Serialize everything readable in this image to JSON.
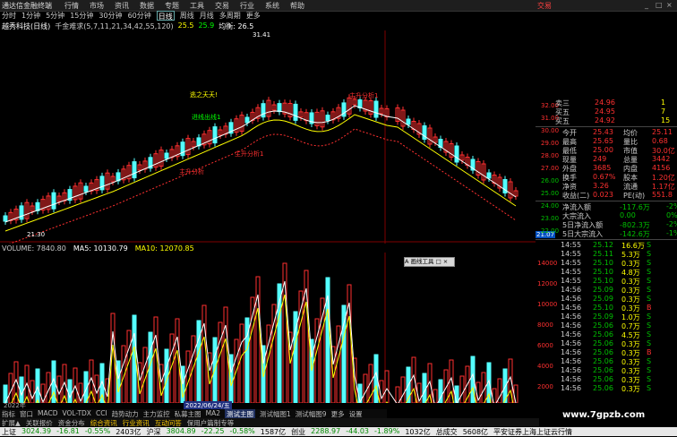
{
  "menubar": {
    "app_title": "通达信金融终端",
    "items": [
      "行情",
      "市场",
      "资讯",
      "数据",
      "专题",
      "工具",
      "交易",
      "行业",
      "系统",
      "帮助"
    ],
    "trade_label": "交易",
    "win_buttons": [
      "_",
      "□",
      "×"
    ]
  },
  "periodbar": {
    "items": [
      "分时",
      "1分钟",
      "5分钟",
      "15分钟",
      "30分钟",
      "60分钟",
      "日线",
      "周线",
      "月线",
      "多周期",
      "更多"
    ],
    "active": "日线"
  },
  "main_legend": {
    "stock": "越秀科技(日线)",
    "indicator": "千金难求(5,7,11,21,34,42,55,120)",
    "top_label": "25.5",
    "mid_label": "25.9",
    "avg_label": "均衡: 26.5"
  },
  "annotations": {
    "chart_labels": [
      "逃之夭夭!",
      "进线出线1",
      "主升分析1",
      "主升分析",
      "主升分析1"
    ],
    "right_axis_low": "21.07",
    "left_low": "21.30",
    "top_high": "31.41",
    "markers": [
      "消",
      "消",
      "消",
      "消",
      "消"
    ]
  },
  "vol_legend": {
    "volume": "VOLUME: 7840.80",
    "ma5": "MA5: 10130.79",
    "ma10": "MA10: 12070.85"
  },
  "date_label": "2022/06/24/五",
  "year_label": "2022年",
  "floating_button": "A 画线工具 □ ×",
  "indicator_tabs": [
    "指标",
    "窗口",
    "MACD",
    "VOL-TDX",
    "CCI",
    "趋势动力",
    "主力监控",
    "私募主图",
    "MA2",
    "测试主图",
    "测试幅图1",
    "测试幅图9",
    "更多",
    "设置"
  ],
  "bottom_tabs": [
    "扩展▲",
    "关联报价",
    "资金分布",
    "综合资讯",
    "行业资讯",
    "互动问答",
    "保用户篇制专等"
  ],
  "status": {
    "sh_label": "上证",
    "sh_val": "3024.39",
    "sh_chg": "-16.81",
    "sh_pct": "-0.55%",
    "sh_amt": "2403亿",
    "sz_label": "沪深",
    "sz_val": "3804.89",
    "sz_chg": "-22.25",
    "sz_pct": "-0.58%",
    "sz_amt": "1587亿",
    "cy_label": "创业",
    "cy_val": "2288.97",
    "cy_chg": "-44.03",
    "cy_pct": "-1.89%",
    "cy_amt": "1032亿",
    "total_label": "总成交",
    "total_amt": "5608亿",
    "broker": "平安证券上海上证云行情"
  },
  "watermark": "www.7gpzb.com",
  "right_axis_ticks": [
    "32.00",
    "31.00",
    "30.00",
    "29.00",
    "28.00",
    "27.00",
    "26.00",
    "25.00",
    "24.00",
    "23.00",
    "22.00"
  ],
  "vol_axis_ticks": [
    "14000",
    "12000",
    "10000",
    "8000",
    "6000",
    "4000",
    "2000"
  ],
  "quote_panel": {
    "ask": [
      {
        "label": "卖三",
        "price": "24.96",
        "vol": "1"
      },
      {
        "label": "买五",
        "price": "24.95",
        "vol": "7"
      },
      {
        "label": "买五",
        "price": "24.92",
        "vol": "15"
      }
    ],
    "fields": [
      {
        "l1": "今开",
        "v1": "25.43",
        "l2": "均价",
        "v2": "25.11"
      },
      {
        "l1": "最高",
        "v1": "25.65",
        "l2": "量比",
        "v2": "0.68"
      },
      {
        "l1": "最低",
        "v1": "25.00",
        "l2": "市值",
        "v2": "30.0亿"
      },
      {
        "l1": "现量",
        "v1": "249",
        "l2": "总量",
        "v2": "3442"
      },
      {
        "l1": "外盘",
        "v1": "3685",
        "l2": "内盘",
        "v2": "4156"
      },
      {
        "l1": "换手",
        "v1": "0.67%",
        "l2": "股本",
        "v2": "1.20亿"
      },
      {
        "l1": "净资",
        "v1": "3.26",
        "l2": "流通",
        "v2": "1.17亿"
      },
      {
        "l1": "收益(二)",
        "v1": "0.023",
        "l2": "PE(动)",
        "v2": "551.8"
      }
    ],
    "flows": [
      {
        "label": "净流入额",
        "val": "-117.6万",
        "pct": "-2%"
      },
      {
        "label": "大宗流入",
        "val": "0.00",
        "pct": "0%"
      },
      {
        "label": "5日净流入额",
        "val": "-802.3万",
        "pct": "-2%"
      },
      {
        "label": "5日大宗流入",
        "val": "-142.6万",
        "pct": "-1%"
      }
    ],
    "ticks": [
      {
        "t": "14:55",
        "p": "25.12",
        "v": "16.6万",
        "s": "S"
      },
      {
        "t": "14:55",
        "p": "25.11",
        "v": "5.3万",
        "s": "S"
      },
      {
        "t": "14:55",
        "p": "25.10",
        "v": "0.3万",
        "s": "S"
      },
      {
        "t": "14:55",
        "p": "25.10",
        "v": "4.8万",
        "s": "S"
      },
      {
        "t": "14:55",
        "p": "25.10",
        "v": "0.3万",
        "s": "S"
      },
      {
        "t": "14:56",
        "p": "25.09",
        "v": "0.3万",
        "s": "S"
      },
      {
        "t": "14:56",
        "p": "25.09",
        "v": "0.3万",
        "s": "S"
      },
      {
        "t": "14:56",
        "p": "25.10",
        "v": "0.3万",
        "s": "B"
      },
      {
        "t": "14:56",
        "p": "25.09",
        "v": "1.0万",
        "s": "S"
      },
      {
        "t": "14:56",
        "p": "25.06",
        "v": "0.7万",
        "s": "S"
      },
      {
        "t": "14:56",
        "p": "25.06",
        "v": "4.5万",
        "s": "S"
      },
      {
        "t": "14:56",
        "p": "25.06",
        "v": "0.3万",
        "s": "S"
      },
      {
        "t": "14:56",
        "p": "25.06",
        "v": "0.3万",
        "s": "B"
      },
      {
        "t": "14:56",
        "p": "25.06",
        "v": "0.3万",
        "s": "S"
      },
      {
        "t": "14:56",
        "p": "25.06",
        "v": "0.3万",
        "s": "S"
      },
      {
        "t": "14:56",
        "p": "25.06",
        "v": "0.3万",
        "s": "S"
      },
      {
        "t": "14:56",
        "p": "25.06",
        "v": "0.3万",
        "s": "S"
      }
    ],
    "current_price": "21.07"
  },
  "colors": {
    "up": "#ff3030",
    "down": "#54ffff",
    "ma5": "#ffffff",
    "ma10": "#ffff00",
    "green": "#00c000",
    "bg": "#000000"
  }
}
